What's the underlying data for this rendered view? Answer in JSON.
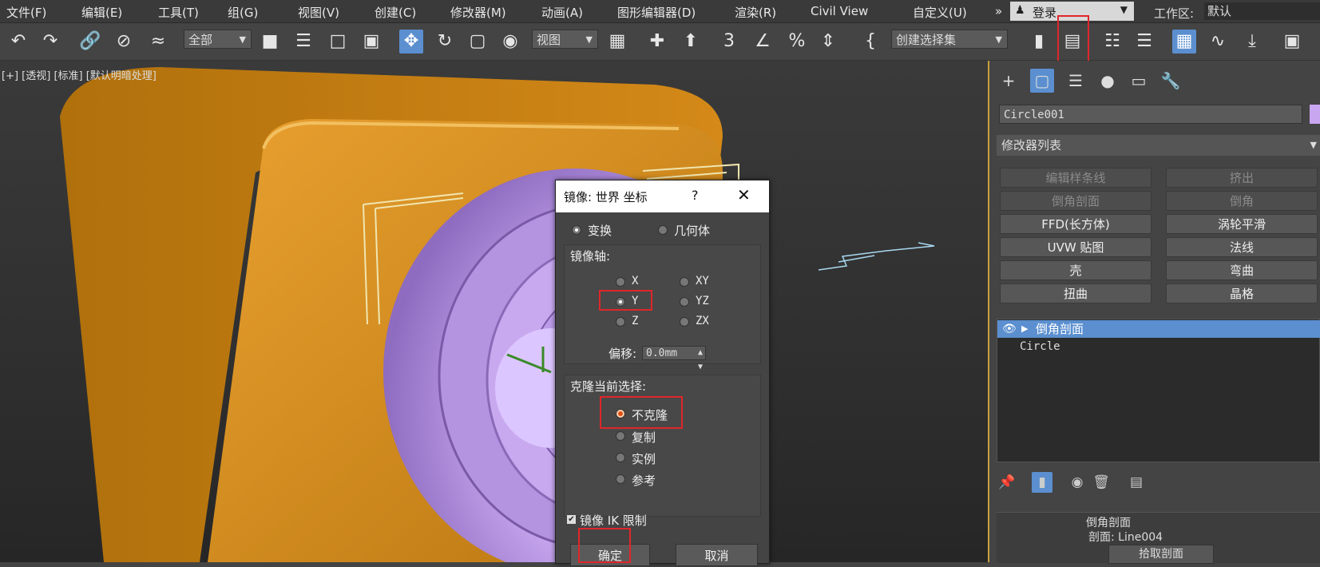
{
  "menu": [
    "文件(F)",
    "编辑(E)",
    "工具(T)",
    "组(G)",
    "视图(V)",
    "创建(C)",
    "修改器(M)",
    "动画(A)",
    "图形编辑器(D)",
    "渲染(R)",
    "Civil View",
    "自定义(U)"
  ],
  "menu_more": "»",
  "login": {
    "icon": "user-icon",
    "label": "登录",
    "caret": "▼"
  },
  "workspace": {
    "label": "工作区:",
    "value": "默认"
  },
  "toolbar": {
    "filter_value": "全部",
    "coord_value": "视图",
    "selection_set": "创建选择集"
  },
  "viewport": {
    "label": "[+] [透视] [标准] [默认明暗处理]"
  },
  "panel": {
    "object_name": "Circle001",
    "modifier_list_label": "修改器列表",
    "buttons": [
      [
        "编辑样条线",
        "挤出"
      ],
      [
        "倒角剖面",
        "倒角"
      ],
      [
        "FFD(长方体)",
        "涡轮平滑"
      ],
      [
        "UVW 贴图",
        "法线"
      ],
      [
        "壳",
        "弯曲"
      ],
      [
        "扭曲",
        "晶格"
      ]
    ],
    "stack": {
      "top": "倒角剖面",
      "child": "Circle"
    },
    "rollout": {
      "title": "倒角剖面",
      "profile_label": "剖面: Line004",
      "pick_button": "拾取剖面"
    }
  },
  "dialog": {
    "title": "镜像: 世界 坐标",
    "help": "?",
    "close": "✕",
    "mode_transform": "变换",
    "mode_geometry": "几何体",
    "axis_group_label": "镜像轴:",
    "axes": {
      "x": "X",
      "y": "Y",
      "z": "Z",
      "xy": "XY",
      "yz": "YZ",
      "zx": "ZX"
    },
    "offset_label": "偏移:",
    "offset_value": "0.0mm",
    "clone_group_label": "克隆当前选择:",
    "clone_options": [
      "不克隆",
      "复制",
      "实例",
      "参考"
    ],
    "mirror_ik_label": "镜像 IK 限制",
    "ok": "确定",
    "cancel": "取消"
  },
  "colors": {
    "highlight": "#e0262b",
    "accent": "#5b8fd0",
    "box": "#e0961f",
    "speaker": "#c4a3ec"
  }
}
